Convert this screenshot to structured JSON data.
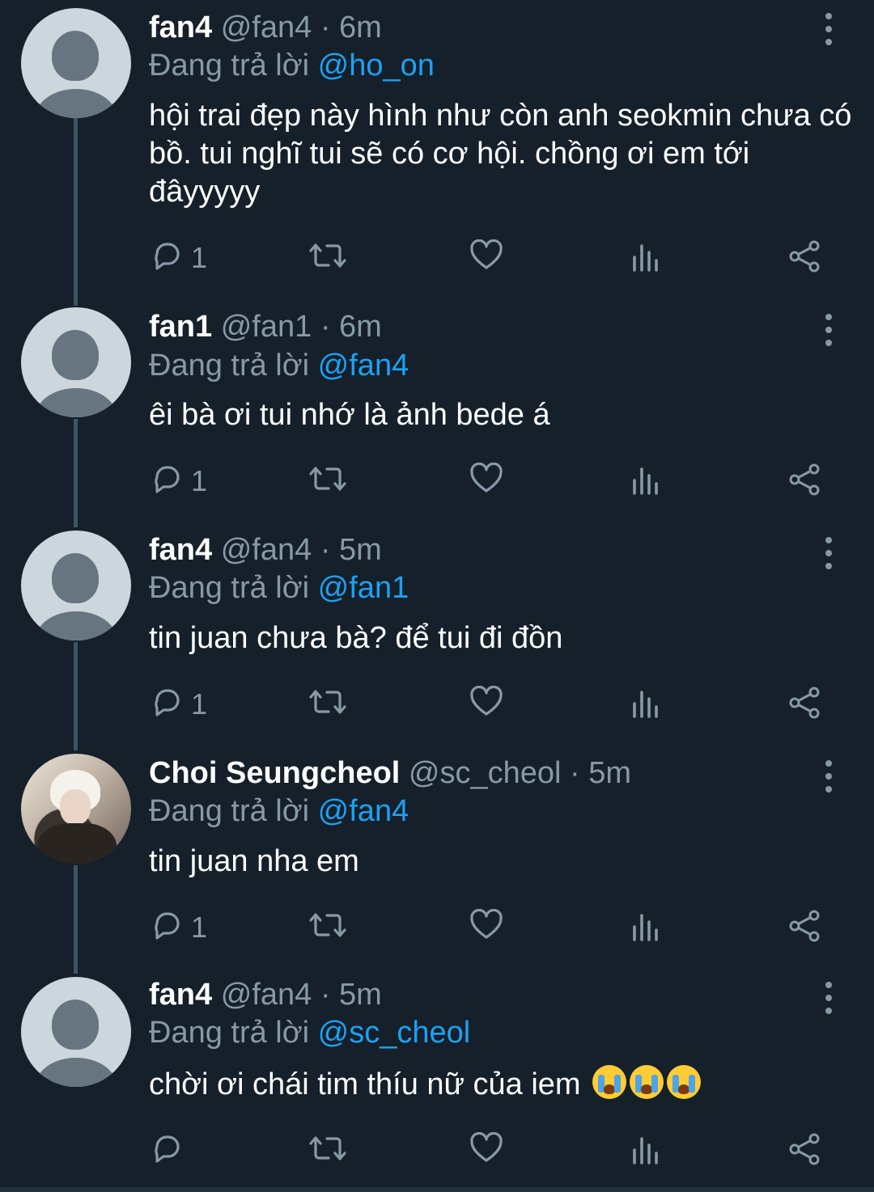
{
  "reply_prefix": "Đang trả lời",
  "tweets": [
    {
      "name": "fan4",
      "handle": "@fan4",
      "time": "· 6m",
      "reply_to": "@ho_on",
      "text": "hội trai đẹp này hình như còn anh seokmin chưa có bồ. tui nghĩ tui sẽ có cơ hội. chồng ơi em tới đâyyyyy",
      "reply_count": "1"
    },
    {
      "name": "fan1",
      "handle": "@fan1",
      "time": "· 6m",
      "reply_to": "@fan4",
      "text": "êi bà ơi tui nhớ là ảnh bede á",
      "reply_count": "1"
    },
    {
      "name": "fan4",
      "handle": "@fan4",
      "time": "· 5m",
      "reply_to": "@fan1",
      "text": "tin juan chưa bà? để tui đi đồn",
      "reply_count": "1"
    },
    {
      "name": "Choi Seungcheol",
      "handle": "@sc_cheol",
      "time": "· 5m",
      "reply_to": "@fan4",
      "text": "tin juan nha em",
      "reply_count": "1"
    },
    {
      "name": "fan4",
      "handle": "@fan4",
      "time": "· 5m",
      "reply_to": "@sc_cheol",
      "text": "chời ơi chái tim thíu nữ của iem",
      "emojis": [
        "loudly-crying-face",
        "loudly-crying-face",
        "loudly-crying-face"
      ],
      "reply_count": ""
    }
  ],
  "icons": {
    "reply": "reply-icon",
    "retweet": "retweet-icon",
    "like": "heart-icon",
    "analytics": "analytics-icon",
    "share": "share-icon",
    "more": "more-vertical-icon"
  },
  "colors": {
    "background": "#15202b",
    "secondary_text": "#8899a6",
    "mention": "#1da1f2",
    "thread_line": "#3d5466"
  }
}
